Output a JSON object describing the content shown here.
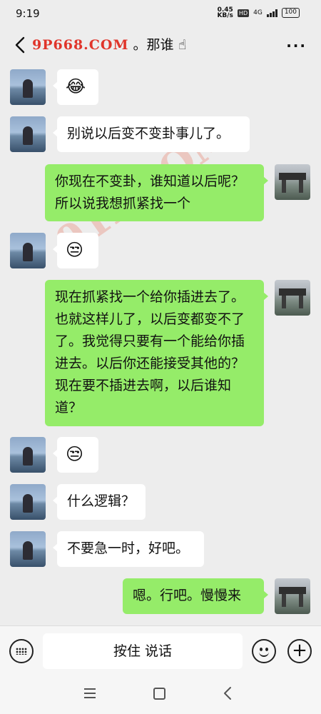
{
  "status": {
    "time": "9:19",
    "net_speed_value": "0.45",
    "net_speed_unit": "KB/s",
    "hd": "HD",
    "network": "4G",
    "battery": "100"
  },
  "header": {
    "watermark": "9P668.COM",
    "title": "。那谁",
    "title_emoji": "☝",
    "more": "···"
  },
  "overlay_watermark": "91P.COM",
  "messages": [
    {
      "side": "left",
      "kind": "emoji",
      "text": "😂"
    },
    {
      "side": "left",
      "kind": "text",
      "text": "别说以后变不变卦事儿了。"
    },
    {
      "side": "right",
      "kind": "text",
      "text": "你现在不变卦，谁知道以后呢？所以说我想抓紧找一个"
    },
    {
      "side": "left",
      "kind": "emoji",
      "text": "😒"
    },
    {
      "side": "right",
      "kind": "text",
      "text": "现在抓紧找一个给你插进去了。也就这样儿了，以后变都变不了了。我觉得只要有一个能给你插进去。以后你还能接受其他的？现在要不插进去啊，以后谁知道？"
    },
    {
      "side": "left",
      "kind": "emoji",
      "text": "😒"
    },
    {
      "side": "left",
      "kind": "text",
      "text": "什么逻辑？"
    },
    {
      "side": "left",
      "kind": "text",
      "text": "不要急一时，好吧。"
    },
    {
      "side": "right",
      "kind": "text",
      "text": "嗯。行吧。慢慢来"
    }
  ],
  "input": {
    "hold_to_talk": "按住 说话",
    "plus": "+"
  }
}
